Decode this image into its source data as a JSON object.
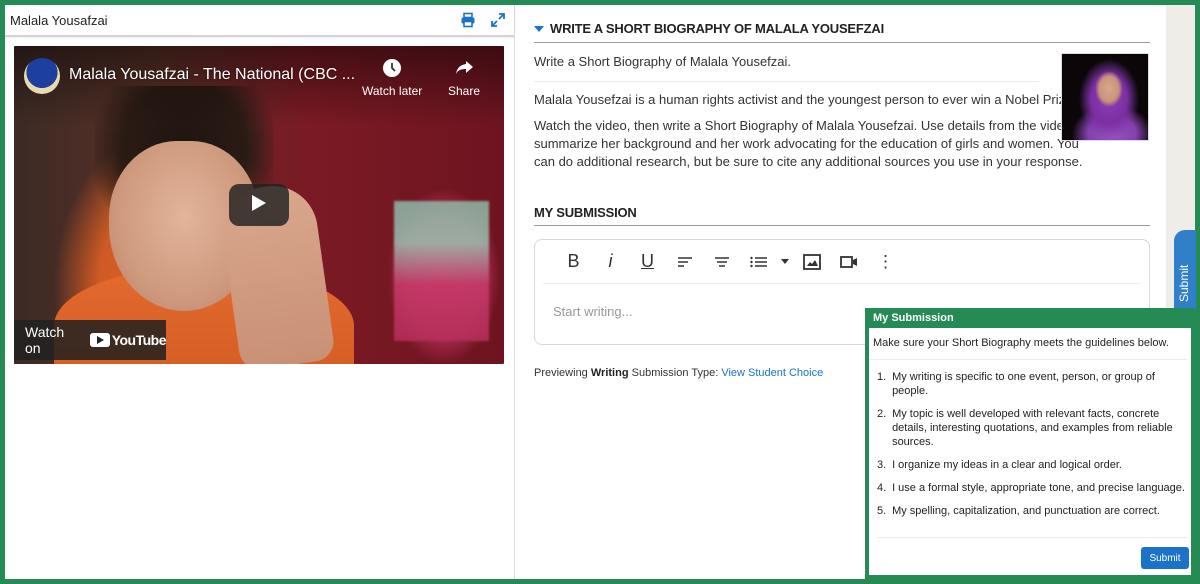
{
  "left_panel": {
    "title": "Malala Yousafzai",
    "print_icon": "print-icon",
    "expand_icon": "expand-icon"
  },
  "video": {
    "title": "Malala Yousafzai - The National (CBC ...",
    "watch_later_label": "Watch later",
    "share_label": "Share",
    "watch_on_label": "Watch on",
    "youtube_label": "YouTube",
    "play_icon": "play-icon"
  },
  "prompt": {
    "section_title": "WRITE A SHORT BIOGRAPHY OF MALALA YOUSEFZAI",
    "line1": "Write a Short Biography of Malala Yousefzai.",
    "line2": "Malala Yousefzai is a human rights activist and the youngest person to ever win a Nobel Prize.",
    "line3": "Watch the video, then write a Short Biography of Malala Yousefzai. Use details from the video to summarize her background and her work advocating for the education of girls and women. You can do additional research, but be sure to cite any additional sources you use in your response."
  },
  "submission": {
    "section_title": "MY SUBMISSION",
    "toolbar": [
      {
        "name": "bold-button",
        "label": "B"
      },
      {
        "name": "italic-button",
        "label": "i"
      },
      {
        "name": "underline-button",
        "label": "U"
      },
      {
        "name": "align-left-button",
        "label": ""
      },
      {
        "name": "align-center-button",
        "label": ""
      },
      {
        "name": "list-button",
        "label": ""
      },
      {
        "name": "insert-image-button",
        "label": ""
      },
      {
        "name": "insert-video-button",
        "label": ""
      },
      {
        "name": "more-options-button",
        "label": "⋮"
      }
    ],
    "placeholder": "Start writing...",
    "preview_prefix": "Previewing",
    "preview_type": "Writing",
    "preview_suffix": "Submission Type:",
    "view_student_choice": "View Student Choice"
  },
  "side_tab": {
    "label": "Submit"
  },
  "popup": {
    "title": "My Submission",
    "intro": "Make sure your Short Biography meets the guidelines below.",
    "guidelines": [
      {
        "num": "1.",
        "text": "My writing is specific to one event, person, or group of people."
      },
      {
        "num": "2.",
        "text": "My topic is well developed with relevant facts, concrete details, interesting quotations, and examples from reliable sources."
      },
      {
        "num": "3.",
        "text": "I organize my ideas in a clear and logical order."
      },
      {
        "num": "4.",
        "text": "I use a formal style, appropriate tone, and precise language."
      },
      {
        "num": "5.",
        "text": "My spelling, capitalization, and punctuation are correct."
      }
    ],
    "submit_label": "Submit"
  },
  "colors": {
    "frame_green": "#268a55",
    "link_blue": "#1a73c8",
    "tab_blue": "#2f7fc9"
  }
}
